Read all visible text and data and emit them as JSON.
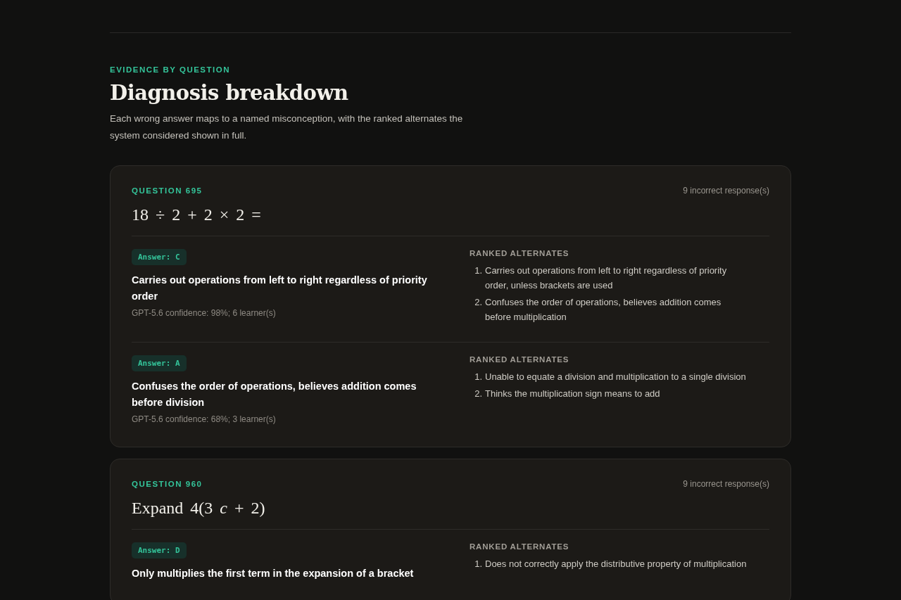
{
  "section": {
    "eyebrow": "EVIDENCE BY QUESTION",
    "title": "Diagnosis breakdown",
    "description": "Each wrong answer maps to a named misconception, with the ranked alternates the system considered shown in full."
  },
  "questions": [
    {
      "label": "QUESTION 695",
      "count": "9 incorrect response(s)",
      "prompt": "18 ÷ 2 + 2 × 2 =",
      "answers": [
        {
          "answer": "Answer: C",
          "misconception": "Carries out operations from left to right regardless of priority order",
          "meta": "GPT-5.6 confidence: 98%; 6 learner(s)",
          "alternates_heading": "RANKED ALTERNATES",
          "alternates": [
            {
              "rank": "1.",
              "text": "Carries out operations from left to right regardless of priority order, unless brackets are used"
            },
            {
              "rank": "2.",
              "text": "Confuses the order of operations, believes addition comes before multiplication"
            }
          ]
        },
        {
          "answer": "Answer: A",
          "misconception": "Confuses the order of operations, believes addition comes before division",
          "meta": "GPT-5.6 confidence: 68%; 3 learner(s)",
          "alternates_heading": "RANKED ALTERNATES",
          "alternates": [
            {
              "rank": "1.",
              "text": "Unable to equate a division and multiplication to a single division"
            },
            {
              "rank": "2.",
              "text": "Thinks the multiplication sign means to add"
            }
          ]
        }
      ]
    },
    {
      "label": "QUESTION 960",
      "count": "9 incorrect response(s)",
      "prompt": "Expand 4(3 *c* + 2)",
      "answers": [
        {
          "answer": "Answer: D",
          "misconception": "Only multiplies the first term in the expansion of a bracket",
          "alternates_heading": "RANKED ALTERNATES",
          "alternates": [
            {
              "rank": "1.",
              "text": "Does not correctly apply the distributive property of multiplication"
            }
          ]
        }
      ]
    }
  ]
}
